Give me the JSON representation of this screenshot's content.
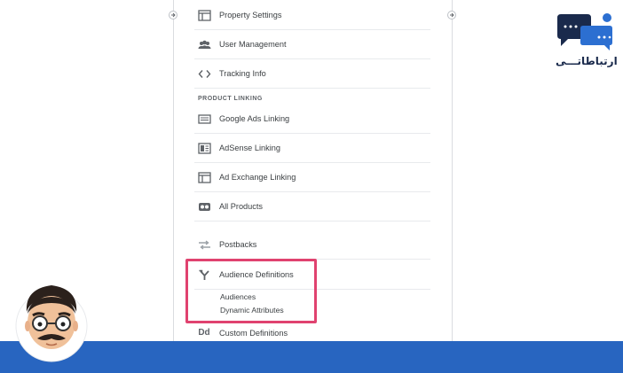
{
  "nav": {
    "items": [
      {
        "id": "property-settings",
        "label": "Property Settings",
        "icon": "layout-icon"
      },
      {
        "id": "user-management",
        "label": "User Management",
        "icon": "users-icon"
      },
      {
        "id": "tracking-info",
        "label": "Tracking Info",
        "icon": "code-icon"
      }
    ],
    "section_product_linking": "PRODUCT LINKING",
    "linking_items": [
      {
        "id": "google-ads-linking",
        "label": "Google Ads Linking",
        "icon": "ads-icon"
      },
      {
        "id": "adsense-linking",
        "label": "AdSense Linking",
        "icon": "adsense-icon"
      },
      {
        "id": "ad-exchange-linking",
        "label": "Ad Exchange Linking",
        "icon": "layout-icon"
      },
      {
        "id": "all-products",
        "label": "All Products",
        "icon": "link-products-icon"
      }
    ],
    "postbacks": {
      "label": "Postbacks",
      "icon": "postbacks-icon"
    },
    "audience_definitions": {
      "label": "Audience Definitions",
      "icon": "fork-icon",
      "sub_items": [
        "Audiences",
        "Dynamic Attributes"
      ]
    },
    "custom_definitions": {
      "label": "Custom Definitions",
      "icon": "dd-icon",
      "icon_text": "Dd"
    }
  },
  "logo": {
    "text": "ارتباطاتـــی",
    "colors": {
      "dark": "#1a2a4c",
      "blue": "#2c6fd1"
    }
  },
  "colors": {
    "highlight": "#e0426f",
    "bottom_bar": "#2865c0"
  }
}
